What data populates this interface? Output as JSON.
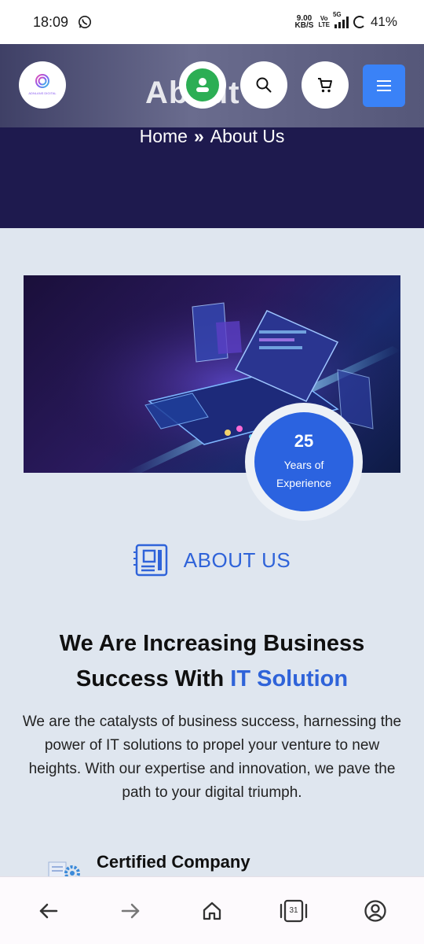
{
  "status_bar": {
    "time": "18:09",
    "net_speed_value": "9.00",
    "net_speed_unit": "KB/S",
    "volte_top": "Vo",
    "volte_bottom": "LTE",
    "network": "5G",
    "battery": "41%"
  },
  "header": {
    "page_title": "About",
    "breadcrumb_home": "Home",
    "breadcrumb_current": "About Us",
    "logo_text": "ADNLANS DIGITAL",
    "colors": {
      "hero_bg": "#1e1a4e",
      "menu_button": "#3a82f7",
      "user_avatar": "#2cae54"
    }
  },
  "experience_badge": {
    "number": "25",
    "line1": "Years of",
    "line2": "Experience"
  },
  "about": {
    "tag": "ABOUT US",
    "heading_part1": "We Are Increasing Business Success With",
    "heading_highlight": "IT Solution",
    "description": "We are the catalysts of business success, harnessing the power of IT solutions to propel your venture to new heights. With our expertise and innovation, we pave the path to your digital triumph.",
    "feature_title": "Certified Company",
    "accent_color": "#2f63d9"
  },
  "bottom_nav": {
    "tab_count": "31"
  }
}
